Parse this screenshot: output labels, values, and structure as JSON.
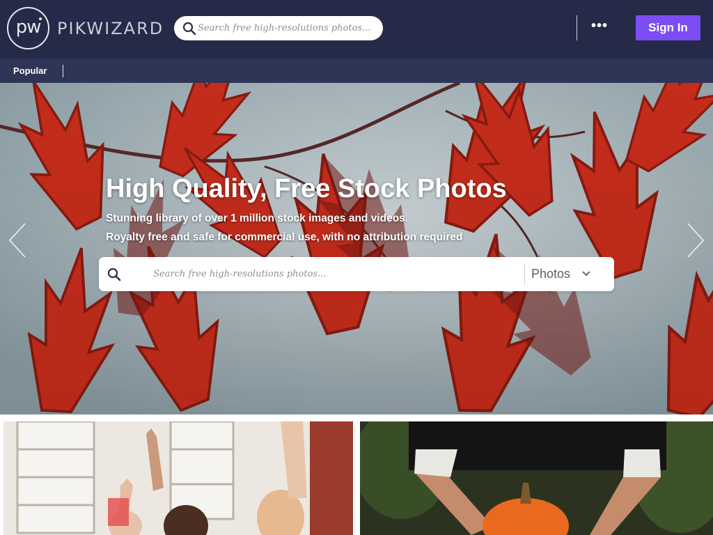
{
  "header": {
    "logo_mark": "pw",
    "logo_text": "PIKWIZARD",
    "search": {
      "placeholder": "Search free high-resolutions photos..."
    },
    "more_label": "•••",
    "signin_label": "Sign In"
  },
  "subnav": {
    "items": [
      {
        "label": "Popular"
      }
    ]
  },
  "hero": {
    "title": "High Quality, Free Stock Photos",
    "subtitle_line1": "Stunning library of over 1 million stock images and videos.",
    "subtitle_line2": "Royalty free and safe for commercial use, with no attribution required",
    "search": {
      "placeholder": "Search free high-resolutions photos...",
      "type_selected": "Photos"
    }
  },
  "icons": {
    "search": "search-icon",
    "chevron": "chevron-down-icon",
    "prev": "chevron-left-icon",
    "next": "chevron-right-icon",
    "more": "more-horizontal-icon"
  },
  "colors": {
    "header_bg": "#242a47",
    "subnav_bg": "#2f3556",
    "accent": "#7c4df3",
    "leaf_red": "#d2331f"
  }
}
